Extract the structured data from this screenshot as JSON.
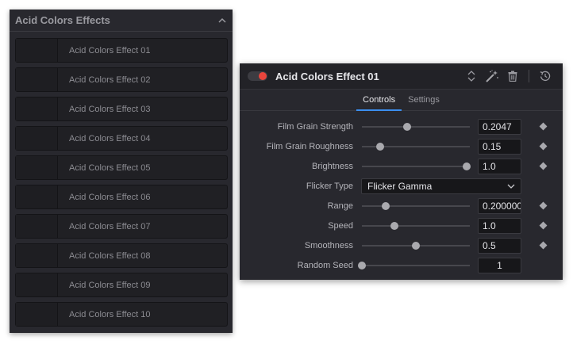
{
  "library": {
    "title": "Acid Colors Effects",
    "items": [
      "Acid Colors Effect 01",
      "Acid Colors Effect 02",
      "Acid Colors Effect 03",
      "Acid Colors Effect 04",
      "Acid Colors Effect 05",
      "Acid Colors Effect 06",
      "Acid Colors Effect 07",
      "Acid Colors Effect 08",
      "Acid Colors Effect 09",
      "Acid Colors Effect 10"
    ]
  },
  "inspector": {
    "title": "Acid Colors Effect 01",
    "enabled": true,
    "accent_color": "#e8453c",
    "tab_accent_color": "#3b8ff0",
    "icons": [
      "reorder-arrows-icon",
      "magic-wand-icon",
      "trash-icon",
      "reset-icon"
    ],
    "tabs": [
      {
        "label": "Controls",
        "active": true
      },
      {
        "label": "Settings",
        "active": false
      }
    ],
    "controls": [
      {
        "label": "Film Grain Strength",
        "value": "0.2047",
        "slider_fraction": 0.42,
        "keyframe": true
      },
      {
        "label": "Film Grain Roughness",
        "value": "0.15",
        "slider_fraction": 0.17,
        "keyframe": true
      },
      {
        "label": "Brightness",
        "value": "1.0",
        "slider_fraction": 0.97,
        "keyframe": true
      },
      {
        "label": "Flicker Type",
        "select_value": "Flicker Gamma"
      },
      {
        "label": "Range",
        "value": "0.200000",
        "slider_fraction": 0.22,
        "keyframe": true
      },
      {
        "label": "Speed",
        "value": "1.0",
        "slider_fraction": 0.3,
        "keyframe": true
      },
      {
        "label": "Smoothness",
        "value": "0.5",
        "slider_fraction": 0.5,
        "keyframe": true
      },
      {
        "label": "Random Seed",
        "value": "1",
        "slider_fraction": 0.0,
        "keyframe": false,
        "center": true
      }
    ]
  }
}
